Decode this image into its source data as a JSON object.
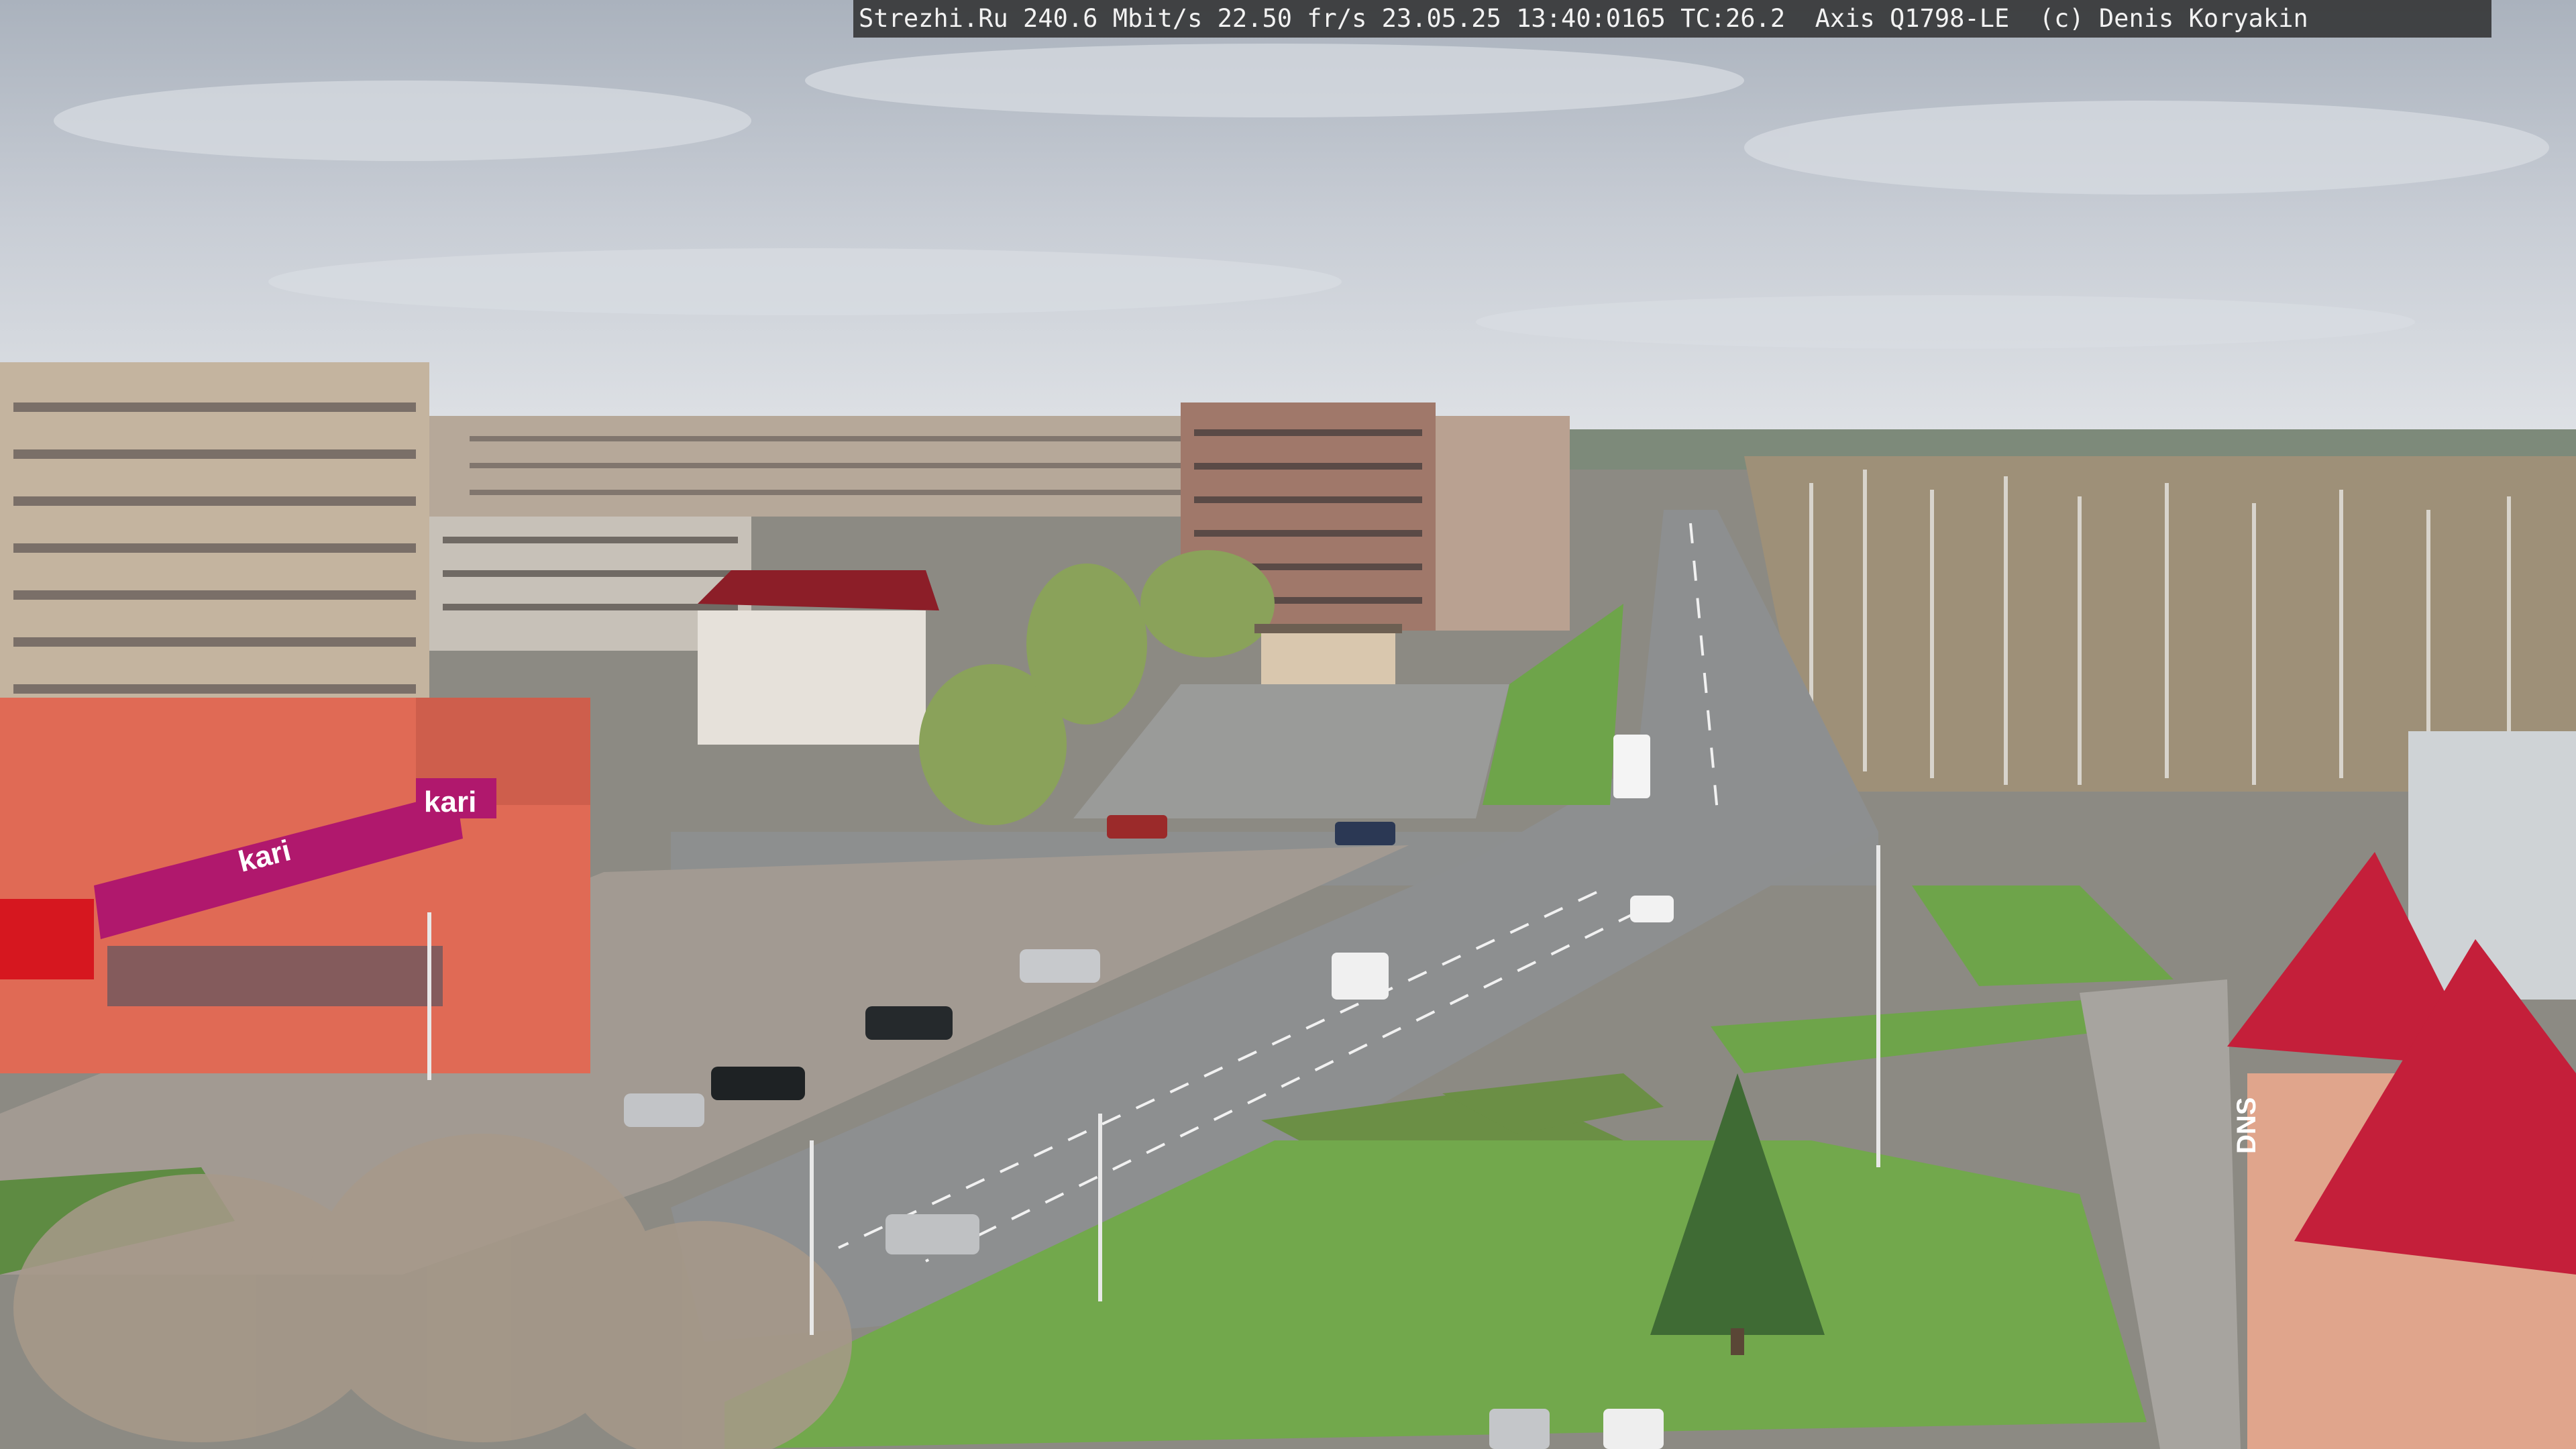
{
  "overlay": {
    "text": "Strezhi.Ru 240.6 Mbit/s 22.50 fr/s 23.05.25 13:40:0165 TC:26.2  Axis Q1798-LE  (c) Denis Koryakin"
  },
  "signs": {
    "kari_left": "kari",
    "kari_right": "kari",
    "dns": "DNS"
  },
  "colors": {
    "sky": "#c9ced6",
    "road": "#8d8f90",
    "grass": "#6ea44a",
    "shop_wall": "#e06a55",
    "kari_banner": "#b0186d",
    "roof_red": "#c41f3a"
  }
}
